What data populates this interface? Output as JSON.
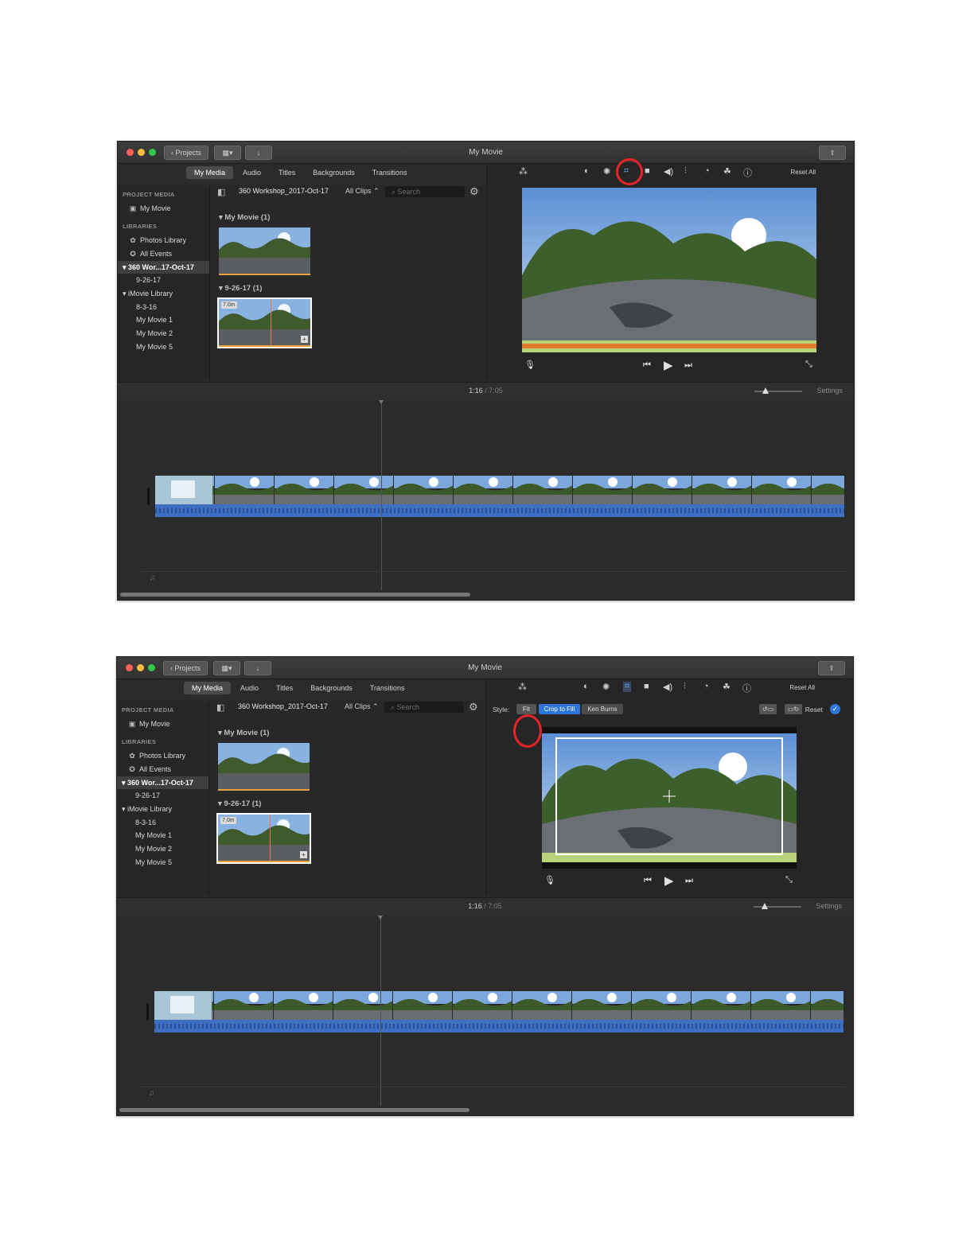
{
  "window": {
    "title": "My Movie",
    "projects_button": "Projects"
  },
  "tabs": [
    "My Media",
    "Audio",
    "Titles",
    "Backgrounds",
    "Transitions"
  ],
  "sidebar": {
    "project_media_header": "PROJECT MEDIA",
    "project_item": "My Movie",
    "libraries_header": "LIBRARIES",
    "photos_library": "Photos Library",
    "all_events": "All Events",
    "library_360": "360 Wor...17-Oct-17",
    "event_9_26": "9-26-17",
    "imovie_library": "iMovie Library",
    "imovie_items": [
      "8-3-16",
      "My Movie 1",
      "My Movie 2",
      "My Movie 5"
    ]
  },
  "browser": {
    "event_name": "360 Workshop_2017-Oct-17",
    "filter": "All Clips",
    "search_placeholder": "Search",
    "groups": [
      {
        "label": "My Movie  (1)"
      },
      {
        "label": "9-26-17  (1)",
        "clip_duration": "7.0m"
      }
    ]
  },
  "viewer": {
    "reset_all": "Reset All",
    "crop_style_label": "Style:",
    "crop_styles": [
      "Fit",
      "Crop to Fill",
      "Ken Burns"
    ],
    "selected_crop_style": "Crop to Fill",
    "reset": "Reset",
    "tool_icons": [
      "magic-wand-icon",
      "color-balance-icon",
      "color-correction-icon",
      "crop-icon",
      "stabilization-icon",
      "volume-icon",
      "noise-reduction-icon",
      "speed-icon",
      "clip-filter-icon",
      "info-icon"
    ]
  },
  "timeline": {
    "current_time": "1:16",
    "separator": "/",
    "total_time": "7:05",
    "settings": "Settings"
  },
  "annotations": {
    "highlight_color": "#e8242b"
  },
  "colors": {
    "accent_blue": "#2d75d6",
    "audio_wave": "#3f6fc2",
    "clip_edge_orange": "#e8a23a"
  }
}
